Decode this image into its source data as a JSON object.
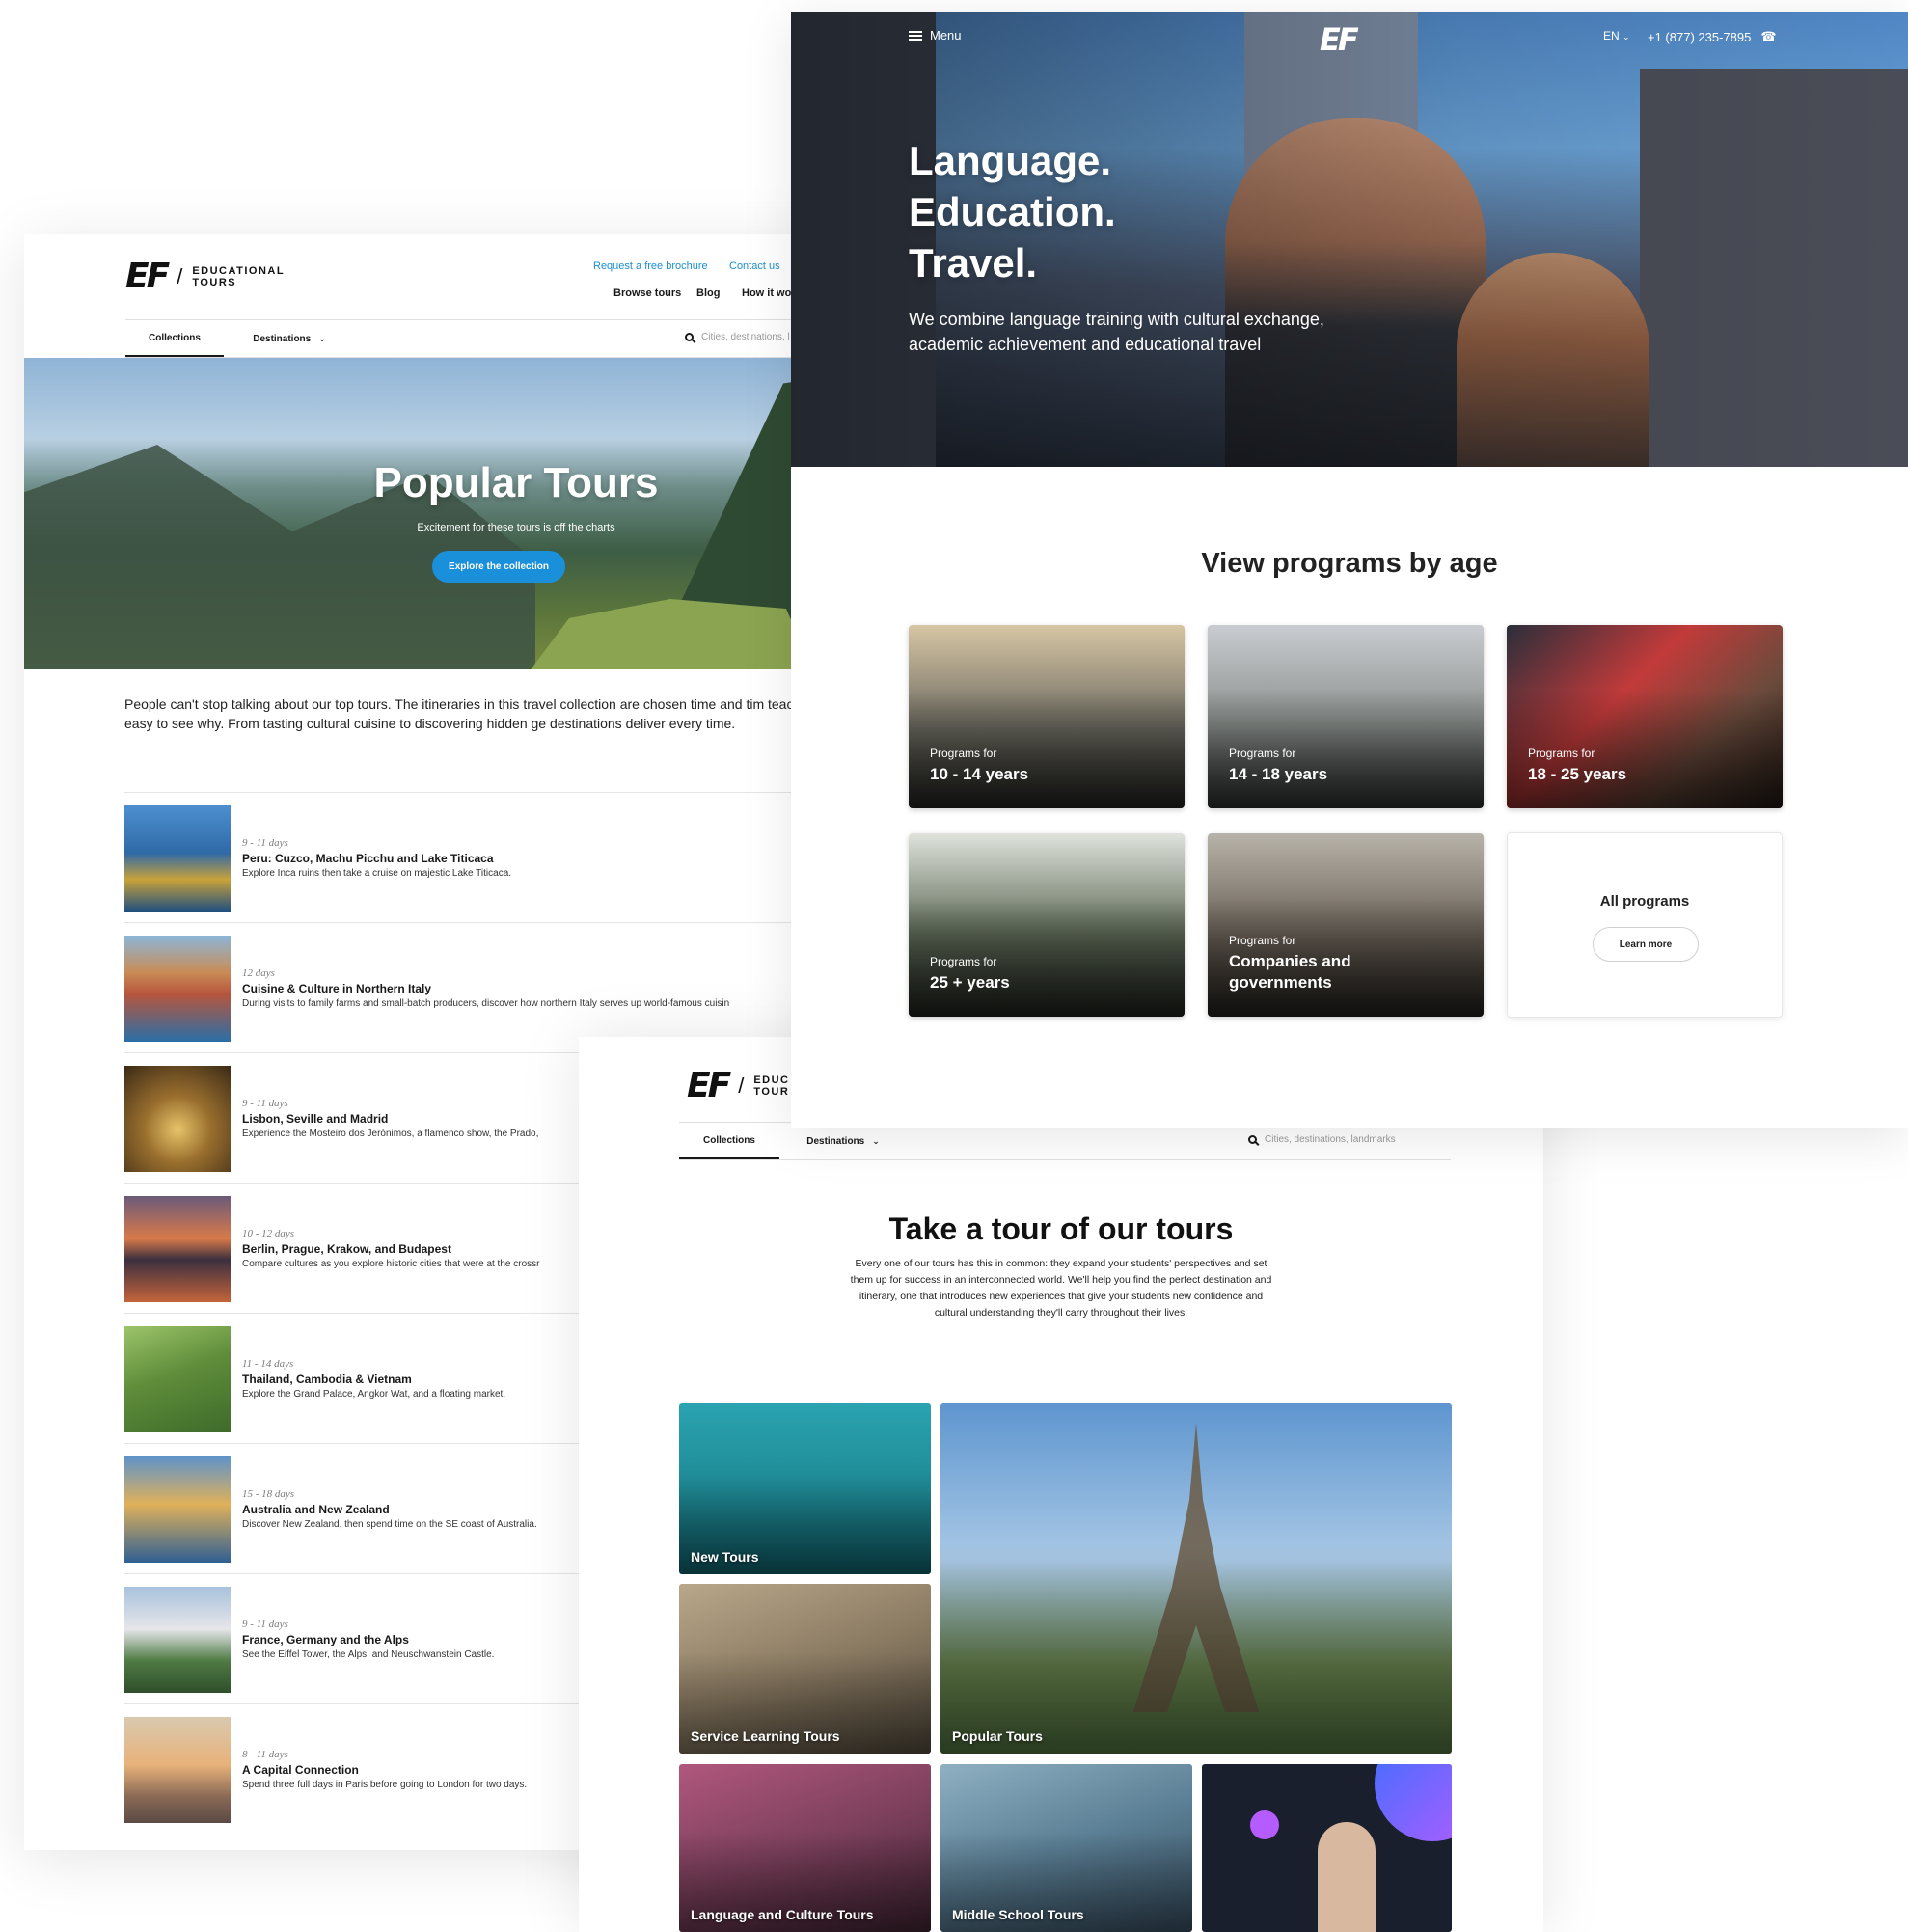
{
  "tours_page": {
    "logo": {
      "mark": "EF",
      "line1": "EDUCATIONAL",
      "line2": "TOURS"
    },
    "top_links": {
      "brochure": "Request a free brochure",
      "contact": "Contact us"
    },
    "main_nav": {
      "browse": "Browse tours",
      "blog": "Blog",
      "how": "How it wo"
    },
    "subnav": {
      "collections": "Collections",
      "destinations": "Destinations",
      "search_placeholder": "Cities, destinations, l"
    },
    "hero": {
      "title": "Popular Tours",
      "subtitle": "Excitement for these tours is off the charts",
      "button": "Explore the collection"
    },
    "intro": "People can't stop talking about our top tours. The itineraries in this travel collection are chosen time and tim teachers, students, and parents. It's easy to see why. From tasting cultural cuisine to discovering hidden ge destinations deliver every time.",
    "tours": [
      {
        "days": "9 - 11 days",
        "name": "Peru: Cuzco, Machu Picchu and Lake Titicaca",
        "desc": "Explore Inca ruins then take a cruise on majestic Lake Titicaca.",
        "thumb_color": "#2f6aa6"
      },
      {
        "days": "12 days",
        "name": "Cuisine & Culture in Northern Italy",
        "desc": "During visits to family farms and small-batch producers, discover how northern Italy serves up world-famous cuisin",
        "thumb_color": "#3f86b8"
      },
      {
        "days": "9 - 11 days",
        "name": "Lisbon, Seville and Madrid",
        "desc": "Experience the Mosteiro dos Jerónimos, a flamenco show, the Prado,",
        "thumb_color": "#7a5a2e"
      },
      {
        "days": "10 - 12 days",
        "name": "Berlin, Prague, Krakow, and Budapest",
        "desc": "Compare cultures as you explore historic cities that were at the crossr",
        "thumb_color": "#b8613f"
      },
      {
        "days": "11 - 14 days",
        "name": "Thailand, Cambodia & Vietnam",
        "desc": "Explore the Grand Palace, Angkor Wat, and a floating market.",
        "thumb_color": "#5f8d3a"
      },
      {
        "days": "15 - 18 days",
        "name": "Australia and New Zealand",
        "desc": "Discover New Zealand, then spend time on the SE coast of Australia.",
        "thumb_color": "#3a6fa5"
      },
      {
        "days": "9 - 11 days",
        "name": "France, Germany and the Alps",
        "desc": "See the Eiffel Tower, the Alps, and Neuschwanstein Castle.",
        "thumb_color": "#5a7f4e"
      },
      {
        "days": "8 - 11 days",
        "name": "A Capital Connection",
        "desc": "Spend three full days in Paris before going to London for two days.",
        "thumb_color": "#c69a6a"
      }
    ]
  },
  "tours_collections": {
    "logo": {
      "mark": "EF",
      "line1": "EDUC",
      "line2": "TOUR"
    },
    "subnav": {
      "collections": "Collections",
      "destinations": "Destinations",
      "search_placeholder": "Cities, destinations, landmarks"
    },
    "title": "Take a tour of our tours",
    "description": "Every one of our tours has this in common: they expand your students' perspectives and set them up for success in an interconnected world. We'll help you find the perfect destination and itinerary, one that introduces new experiences that give your students new confidence and cultural understanding they'll carry throughout their lives.",
    "tiles": [
      {
        "label": "New Tours",
        "color": "#1e8a95"
      },
      {
        "label": "Popular Tours",
        "color": "#6d9bcf"
      },
      {
        "label": "Service Learning Tours",
        "color": "#8a7a62"
      },
      {
        "label": "Language and Culture Tours",
        "color": "#7b3f5c"
      },
      {
        "label": "Middle School Tours",
        "color": "#5a7e94"
      },
      {
        "label": "",
        "color": "#1a1f2e"
      }
    ]
  },
  "ef_home": {
    "menu": "Menu",
    "logo": "EF",
    "lang": "EN",
    "phone": "+1 (877) 235-7895",
    "headline": [
      "Language.",
      "Education.",
      "Travel."
    ],
    "subheadline": "We combine language training with cultural exchange, academic achievement and educational travel",
    "section_title": "View programs by age",
    "cards": [
      {
        "small": "Programs for",
        "big": "10 - 14 years",
        "color": "#6f6d63"
      },
      {
        "small": "Programs for",
        "big": "14 - 18 years",
        "color": "#8a8f8c"
      },
      {
        "small": "Programs for",
        "big": "18 - 25 years",
        "color": "#6b4b3c"
      },
      {
        "small": "Programs for",
        "big": "25 + years",
        "color": "#5f6b58"
      },
      {
        "small": "Programs for",
        "big": "Companies and governments",
        "color": "#6b6258"
      }
    ],
    "all_programs": {
      "title": "All programs",
      "button": "Learn more"
    }
  }
}
